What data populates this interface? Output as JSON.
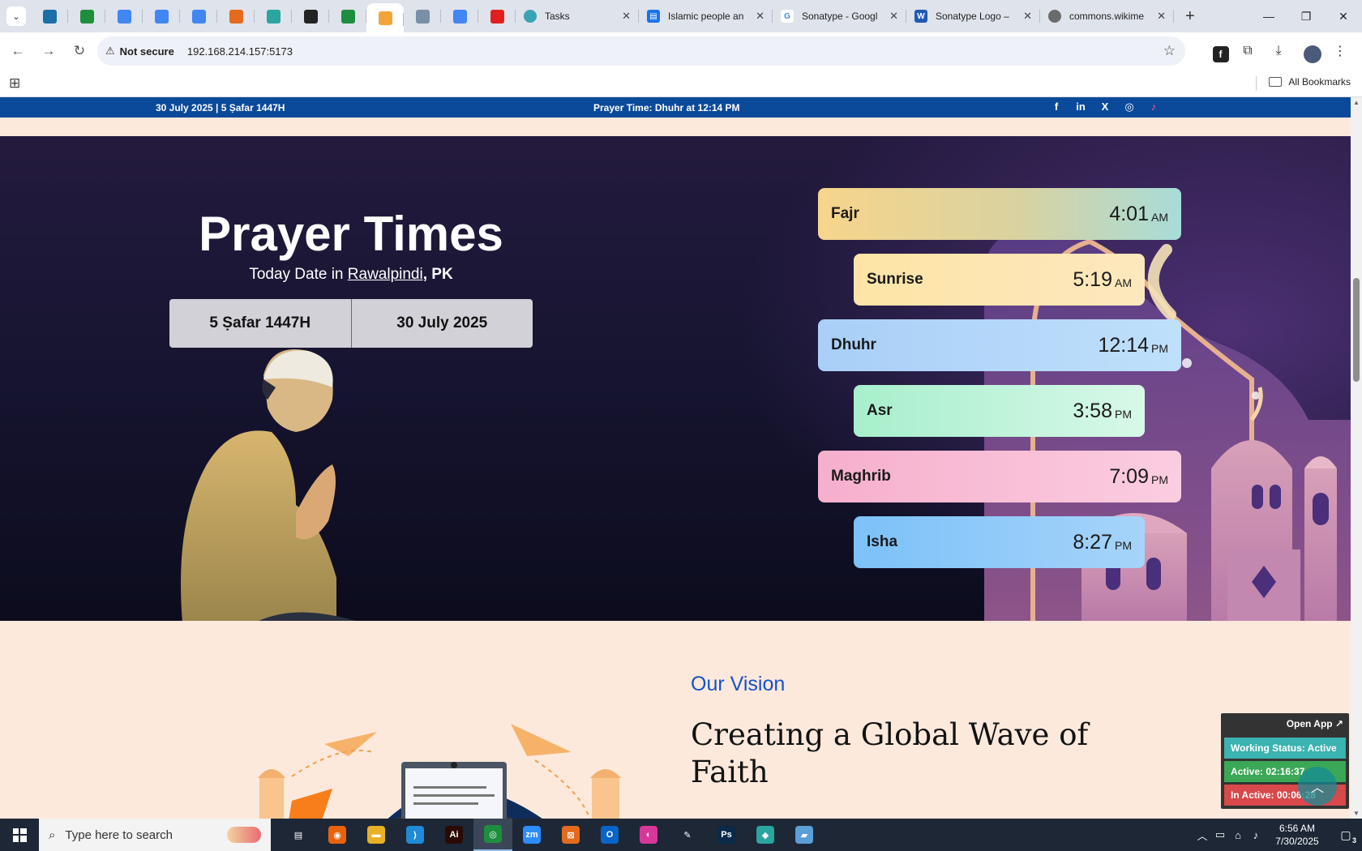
{
  "browser": {
    "tabs": [
      {
        "title": "Tasks",
        "color": "#38a3b5",
        "icon": "tasks-icon"
      },
      {
        "title": "Islamic people an",
        "color": "#1a73e8",
        "icon": "docs-icon"
      },
      {
        "title": "Sonatype - Googl",
        "color": "#4285f4",
        "icon": "google-icon"
      },
      {
        "title": "Sonatype Logo –",
        "color": "#1f5bb5",
        "icon": "word-icon"
      },
      {
        "title": "commons.wikime",
        "color": "#6b6b6b",
        "icon": "globe-icon"
      }
    ],
    "pinned_colors": [
      "#1b6fa6",
      "#1e8e3e",
      "#4285f4",
      "#4285f4",
      "#4285f4",
      "#e46a1e",
      "#2aa5a0",
      "#222222",
      "#1e8e3e",
      "#f2a43a",
      "#7a8fa8",
      "#4285f4",
      "#e02020"
    ],
    "address": {
      "security_label": "Not secure",
      "url": "192.168.214.157:5173"
    },
    "bookmarks": {
      "all_label": "All Bookmarks"
    }
  },
  "topbar": {
    "date": "30 July 2025 | 5 Ṣafar 1447H",
    "prayer_prefix": "Prayer Time:",
    "prayer_name": "Dhuhr",
    "prayer_suffix": "at 12:14 PM",
    "social": [
      "f",
      "in",
      "X",
      "◎",
      "♪"
    ]
  },
  "hero": {
    "title": "Prayer Times",
    "subtitle_prefix": "Today Date in",
    "city": "Rawalpindi",
    "country": ", PK",
    "hijri_date": "5 Ṣafar 1447H",
    "gregorian_date": "30 July 2025"
  },
  "prayers": [
    {
      "name": "Fajr",
      "time": "4:01",
      "ampm": "AM"
    },
    {
      "name": "Sunrise",
      "time": "5:19",
      "ampm": "AM"
    },
    {
      "name": "Dhuhr",
      "time": "12:14",
      "ampm": "PM"
    },
    {
      "name": "Asr",
      "time": "3:58",
      "ampm": "PM"
    },
    {
      "name": "Maghrib",
      "time": "7:09",
      "ampm": "PM"
    },
    {
      "name": "Isha",
      "time": "8:27",
      "ampm": "PM"
    }
  ],
  "vision": {
    "label": "Our Vision",
    "title": "Creating a Global Wave of Faith"
  },
  "widget": {
    "open_label": "Open App ↗",
    "working_status": "Working Status: Active",
    "active": "Active: 02:16:37",
    "inactive": "In Active: 00:06:28"
  },
  "taskbar": {
    "search_placeholder": "Type here to search",
    "time": "6:56 AM",
    "date": "7/30/2025",
    "notification_count": "3",
    "apps": [
      {
        "label": "▤",
        "color": "#1d2736"
      },
      {
        "label": "◉",
        "color": "#e8620e"
      },
      {
        "label": "▬",
        "color": "#e8b025"
      },
      {
        "label": "⟩",
        "color": "#1f8ad6"
      },
      {
        "label": "Ai",
        "color": "#2b0a05"
      },
      {
        "label": "◎",
        "color": "#1e8e3e"
      },
      {
        "label": "zm",
        "color": "#2d8cff"
      },
      {
        "label": "⊠",
        "color": "#e46a1e"
      },
      {
        "label": "O",
        "color": "#0a64c8"
      },
      {
        "label": "◐",
        "color": "#d8379a"
      },
      {
        "label": "✎",
        "color": "#1d2736"
      },
      {
        "label": "Ps",
        "color": "#0b2a4a"
      },
      {
        "label": "◆",
        "color": "#2aa5a0"
      },
      {
        "label": "▰",
        "color": "#5a9fd6"
      }
    ]
  }
}
